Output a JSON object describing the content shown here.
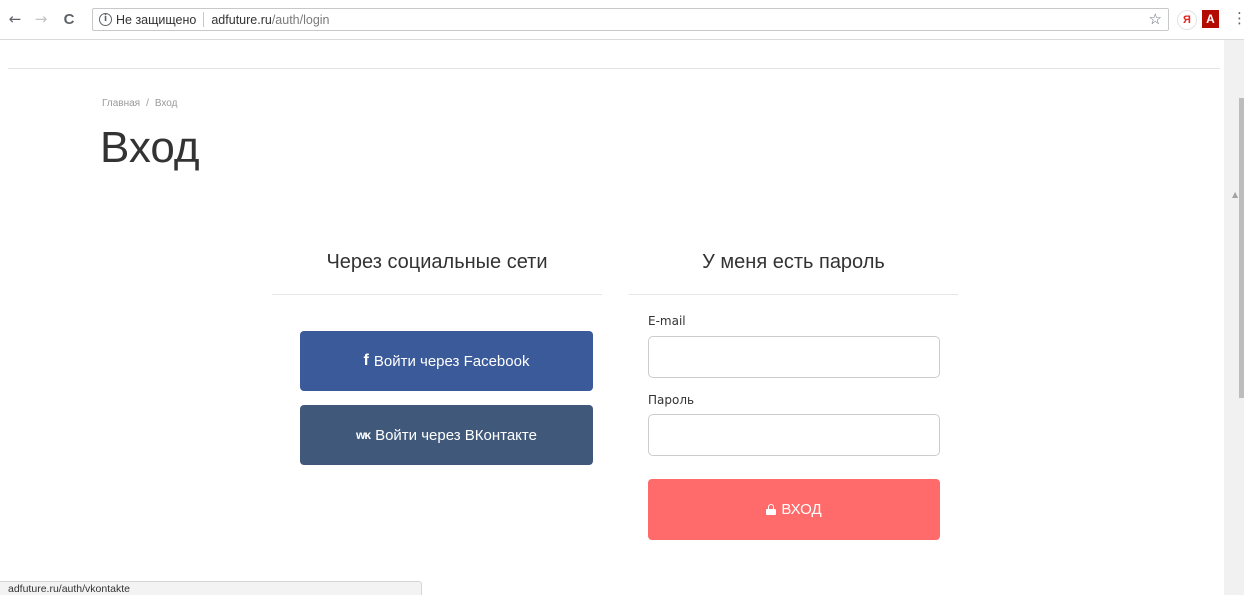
{
  "browser": {
    "back_icon": "←",
    "forward_icon": "→",
    "reload_icon": "C",
    "security_label": "Не защищено",
    "url_host": "adfuture.ru",
    "url_path": "/auth/login",
    "star_icon": "☆",
    "yandex_label": "Я",
    "pdf_label": "A",
    "menu_icon": "⋮"
  },
  "breadcrumb": {
    "home": "Главная",
    "separator": "/",
    "current": "Вход"
  },
  "page": {
    "title": "Вход"
  },
  "social": {
    "heading": "Через социальные сети",
    "facebook_icon": "f",
    "facebook_label": "Войти через Facebook",
    "vk_icon": "ᴡᴋ",
    "vk_label": "Войти через ВКонтакте"
  },
  "login": {
    "heading": "У меня есть пароль",
    "email_label": "E-mail",
    "email_value": "",
    "password_label": "Пароль",
    "password_value": "",
    "submit_label": "ВХОД"
  },
  "status_bar": {
    "url": "adfuture.ru/auth/vkontakte"
  },
  "colors": {
    "facebook": "#3b5a9a",
    "vk": "#40597a",
    "login_button": "#ff6b6b"
  },
  "icons": [
    "back-icon",
    "forward-icon",
    "reload-icon",
    "info-icon",
    "star-icon",
    "facebook-icon",
    "vk-icon",
    "lock-icon",
    "menu-icon"
  ]
}
